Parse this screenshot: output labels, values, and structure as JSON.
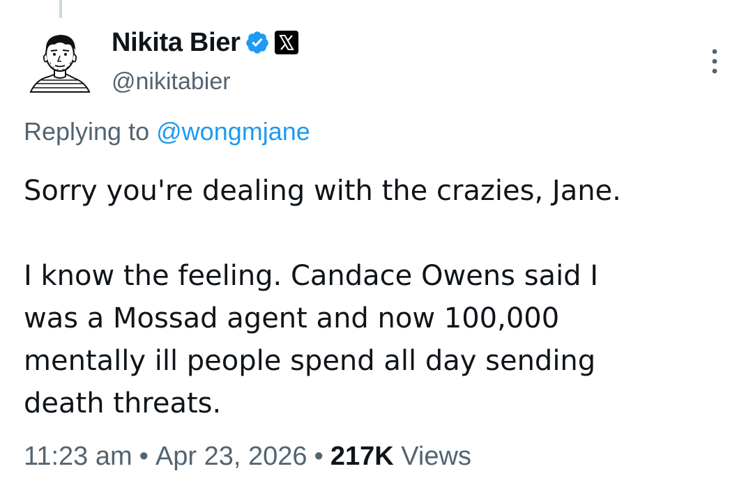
{
  "author": {
    "display_name": "Nikita Bier",
    "handle": "@nikitabier",
    "verified_color": "#1d9bf0",
    "affiliate_badge": "x-logo-icon"
  },
  "reply_context": {
    "prefix": "Replying to",
    "mention": "@wongmjane"
  },
  "tweet": {
    "paragraph_1": "Sorry you're dealing with the crazies, Jane.",
    "paragraph_2_line_1": "I know the feeling. Candace Owens said I",
    "paragraph_2_line_2": "was a Mossad agent and now 100,000",
    "paragraph_2_line_3": "mentally ill people spend all day sending",
    "paragraph_2_line_4": "death threats."
  },
  "meta": {
    "time": "11:23 am",
    "separator": "•",
    "date": "Apr 23, 2026",
    "views_count": "217K",
    "views_label": "Views"
  },
  "colors": {
    "text_primary": "#0f1419",
    "text_secondary": "#536471",
    "link": "#1d9bf0",
    "thread_line": "#cfd9de"
  }
}
